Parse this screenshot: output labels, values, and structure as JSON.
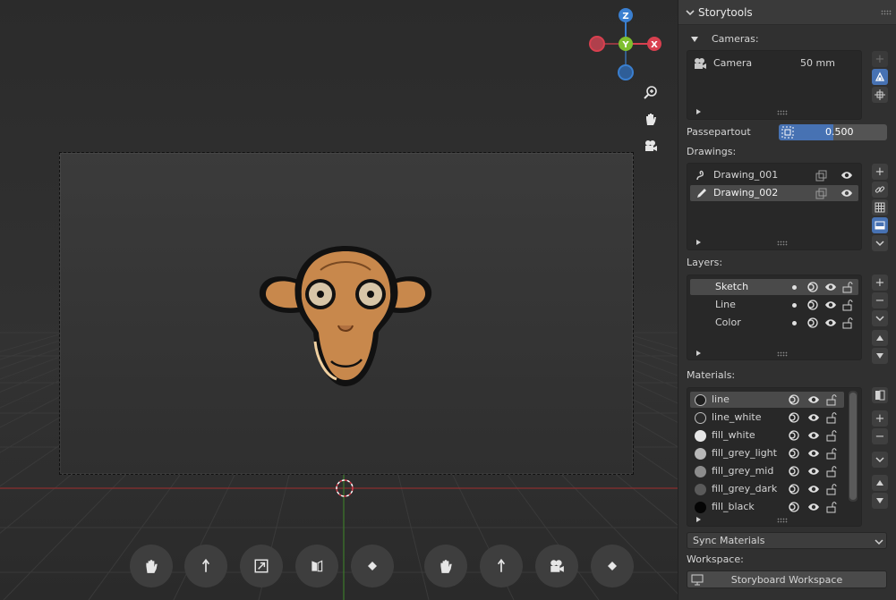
{
  "viewport": {
    "gizmo_axes": {
      "z": "Z",
      "y": "Y",
      "x": "X"
    },
    "colors": {
      "x_axis": "#d8404f",
      "y_axis": "#7fbf2f",
      "z_axis": "#3a7fd0",
      "grid": "#3a3a3a",
      "grid_red": "#8a2f2f",
      "grid_green": "#3c7a2a"
    },
    "nav_icons": [
      "zoom-icon",
      "hand-pan-icon",
      "camera-view-icon"
    ],
    "tool_icons_left": [
      "hand-icon",
      "move-up-icon",
      "scale-icon",
      "rotate-icon",
      "keyframe-icon"
    ],
    "tool_icons_right": [
      "hand-icon",
      "move-up-icon",
      "camera-icon",
      "keyframe-icon"
    ]
  },
  "panel": {
    "title": "Storytools",
    "cameras": {
      "section_label": "Cameras:",
      "items": [
        {
          "name": "Camera",
          "lens": "50 mm"
        }
      ]
    },
    "passepartout": {
      "label": "Passepartout",
      "value": "0.500",
      "fraction": 0.5
    },
    "drawings": {
      "label": "Drawings:",
      "items": [
        {
          "name": "Drawing_001",
          "icon": "stroke-icon",
          "selected": false
        },
        {
          "name": "Drawing_002",
          "icon": "pencil-icon",
          "selected": true
        }
      ]
    },
    "layers": {
      "label": "Layers:",
      "items": [
        {
          "name": "Sketch",
          "selected": true
        },
        {
          "name": "Line",
          "selected": false
        },
        {
          "name": "Color",
          "selected": false
        }
      ]
    },
    "materials": {
      "label": "Materials:",
      "items": [
        {
          "name": "line",
          "swatch": "#1e1e1e",
          "ring": true,
          "selected": true
        },
        {
          "name": "line_white",
          "swatch": "#2a2a2a",
          "ring": true,
          "selected": false
        },
        {
          "name": "fill_white",
          "swatch": "#e6e6e6",
          "ring": false,
          "selected": false
        },
        {
          "name": "fill_grey_light",
          "swatch": "#b8b8b8",
          "ring": false,
          "selected": false
        },
        {
          "name": "fill_grey_mid",
          "swatch": "#8c8c8c",
          "ring": false,
          "selected": false
        },
        {
          "name": "fill_grey_dark",
          "swatch": "#5a5a5a",
          "ring": false,
          "selected": false
        },
        {
          "name": "fill_black",
          "swatch": "#050505",
          "ring": false,
          "selected": false
        }
      ]
    },
    "sync_materials": {
      "label": "Sync Materials"
    },
    "workspace": {
      "label": "Workspace:",
      "button": "Storyboard Workspace"
    },
    "accent": "#4772b3"
  }
}
